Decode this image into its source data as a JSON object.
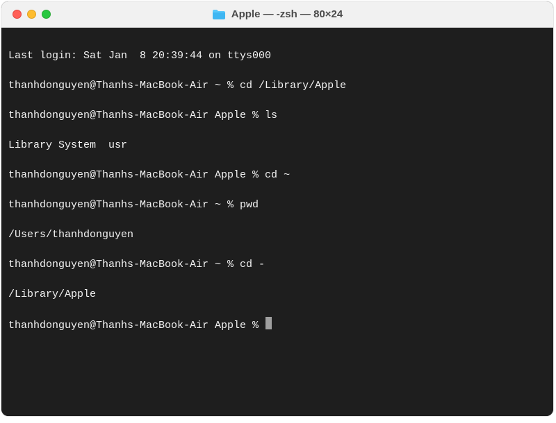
{
  "window": {
    "title": "Apple — -zsh — 80×24"
  },
  "terminal": {
    "lines": {
      "l0": "Last login: Sat Jan  8 20:39:44 on ttys000",
      "l1": "thanhdonguyen@Thanhs-MacBook-Air ~ % cd /Library/Apple",
      "l2": "thanhdonguyen@Thanhs-MacBook-Air Apple % ls",
      "l3": "Library System  usr",
      "l4": "thanhdonguyen@Thanhs-MacBook-Air Apple % cd ~",
      "l5": "thanhdonguyen@Thanhs-MacBook-Air ~ % pwd",
      "l6": "/Users/thanhdonguyen",
      "l7": "thanhdonguyen@Thanhs-MacBook-Air ~ % cd -",
      "l8": "/Library/Apple",
      "l9": "thanhdonguyen@Thanhs-MacBook-Air Apple % "
    }
  }
}
